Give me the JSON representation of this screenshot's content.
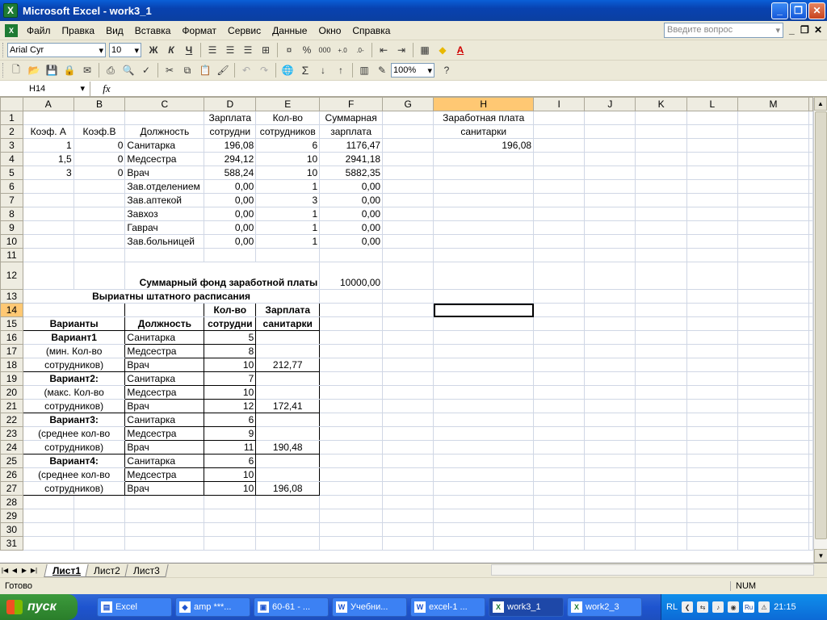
{
  "window": {
    "title": "Microsoft Excel - work3_1",
    "app_icon": "X",
    "min": "_",
    "max": "❐",
    "close": "✕"
  },
  "menu": {
    "items": [
      "Файл",
      "Правка",
      "Вид",
      "Вставка",
      "Формат",
      "Сервис",
      "Данные",
      "Окно",
      "Справка"
    ],
    "help_placeholder": "Введите вопрос"
  },
  "toolbar": {
    "font": "Arial Cyr",
    "size": "10",
    "zoom": "100%",
    "bold": "Ж",
    "italic": "К",
    "underline": "Ч",
    "thousands": "000",
    "percent": "%",
    "sum": "Σ"
  },
  "formula_bar": {
    "cell": "H14",
    "fx": "fx",
    "formula": ""
  },
  "columns": [
    "A",
    "B",
    "C",
    "D",
    "E",
    "F",
    "G",
    "H",
    "I",
    "J",
    "K",
    "L",
    "M"
  ],
  "rows": {
    "r1": {
      "D": "Зарплата",
      "E": "Кол-во",
      "F": "Суммарная",
      "H": "Заработная плата"
    },
    "r2": {
      "A": "Коэф. А",
      "B": "Коэф.В",
      "C": "Должность",
      "D": "сотрудни",
      "E": "сотрудников",
      "F": "зарплата",
      "H": "санитарки"
    },
    "r3": {
      "A": "1",
      "B": "0",
      "C": "Санитарка",
      "D": "196,08",
      "E": "6",
      "F": "1176,47",
      "H": "196,08"
    },
    "r4": {
      "A": "1,5",
      "B": "0",
      "C": "Медсестра",
      "D": "294,12",
      "E": "10",
      "F": "2941,18"
    },
    "r5": {
      "A": "3",
      "B": "0",
      "C": "Врач",
      "D": "588,24",
      "E": "10",
      "F": "5882,35"
    },
    "r6": {
      "C": "Зав.отделением",
      "D": "0,00",
      "E": "1",
      "F": "0,00"
    },
    "r7": {
      "C": "Зав.аптекой",
      "D": "0,00",
      "E": "3",
      "F": "0,00"
    },
    "r8": {
      "C": "Завхоз",
      "D": "0,00",
      "E": "1",
      "F": "0,00"
    },
    "r9": {
      "C": "Гаврач",
      "D": "0,00",
      "E": "1",
      "F": "0,00"
    },
    "r10": {
      "C": "Зав.больницей",
      "D": "0,00",
      "E": "1",
      "F": "0,00"
    },
    "r12": {
      "C": "Суммарный фонд заработной платы",
      "F": "10000,00"
    },
    "r13": {
      "A": "Выриатны штатного расписания"
    },
    "r14": {
      "D": "Кол-во",
      "E": "Зарплата"
    },
    "r15": {
      "A": "Варианты",
      "C": "Должность",
      "D": "сотрудни",
      "E": "санитарки"
    },
    "r16": {
      "A": "Вариант1",
      "C": "Санитарка",
      "D": "5"
    },
    "r17": {
      "A": "(мин. Кол-во",
      "C": "Медсестра",
      "D": "8"
    },
    "r18": {
      "A": "сотрудников)",
      "C": "Врач",
      "D": "10",
      "E": "212,77"
    },
    "r19": {
      "A": "Вариант2:",
      "C": "Санитарка",
      "D": "7"
    },
    "r20": {
      "A": "(макс. Кол-во",
      "C": "Медсестра",
      "D": "10"
    },
    "r21": {
      "A": "сотрудников)",
      "C": "Врач",
      "D": "12",
      "E": "172,41"
    },
    "r22": {
      "A": "Вариант3:",
      "C": "Санитарка",
      "D": "6"
    },
    "r23": {
      "A": "(среднее кол-во",
      "C": "Медсестра",
      "D": "9"
    },
    "r24": {
      "A": "сотрудников)",
      "C": "Врач",
      "D": "11",
      "E": "190,48"
    },
    "r25": {
      "A": "Вариант4:",
      "C": "Санитарка",
      "D": "6"
    },
    "r26": {
      "A": "(среднее кол-во",
      "C": "Медсестра",
      "D": "10"
    },
    "r27": {
      "A": "сотрудников)",
      "C": "Врач",
      "D": "10",
      "E": "196,08"
    }
  },
  "sheets": [
    "Лист1",
    "Лист2",
    "Лист3"
  ],
  "status": {
    "left": "Готово",
    "num": "NUM"
  },
  "taskbar": {
    "start": "пуск",
    "tasks": [
      "Excel",
      "amp ***...",
      "60-61 - ...",
      "Учебни...",
      "excel-1 ...",
      "work3_1",
      "work2_3"
    ],
    "lang": "RL",
    "lang2": "Ru",
    "clock": "21:15"
  }
}
